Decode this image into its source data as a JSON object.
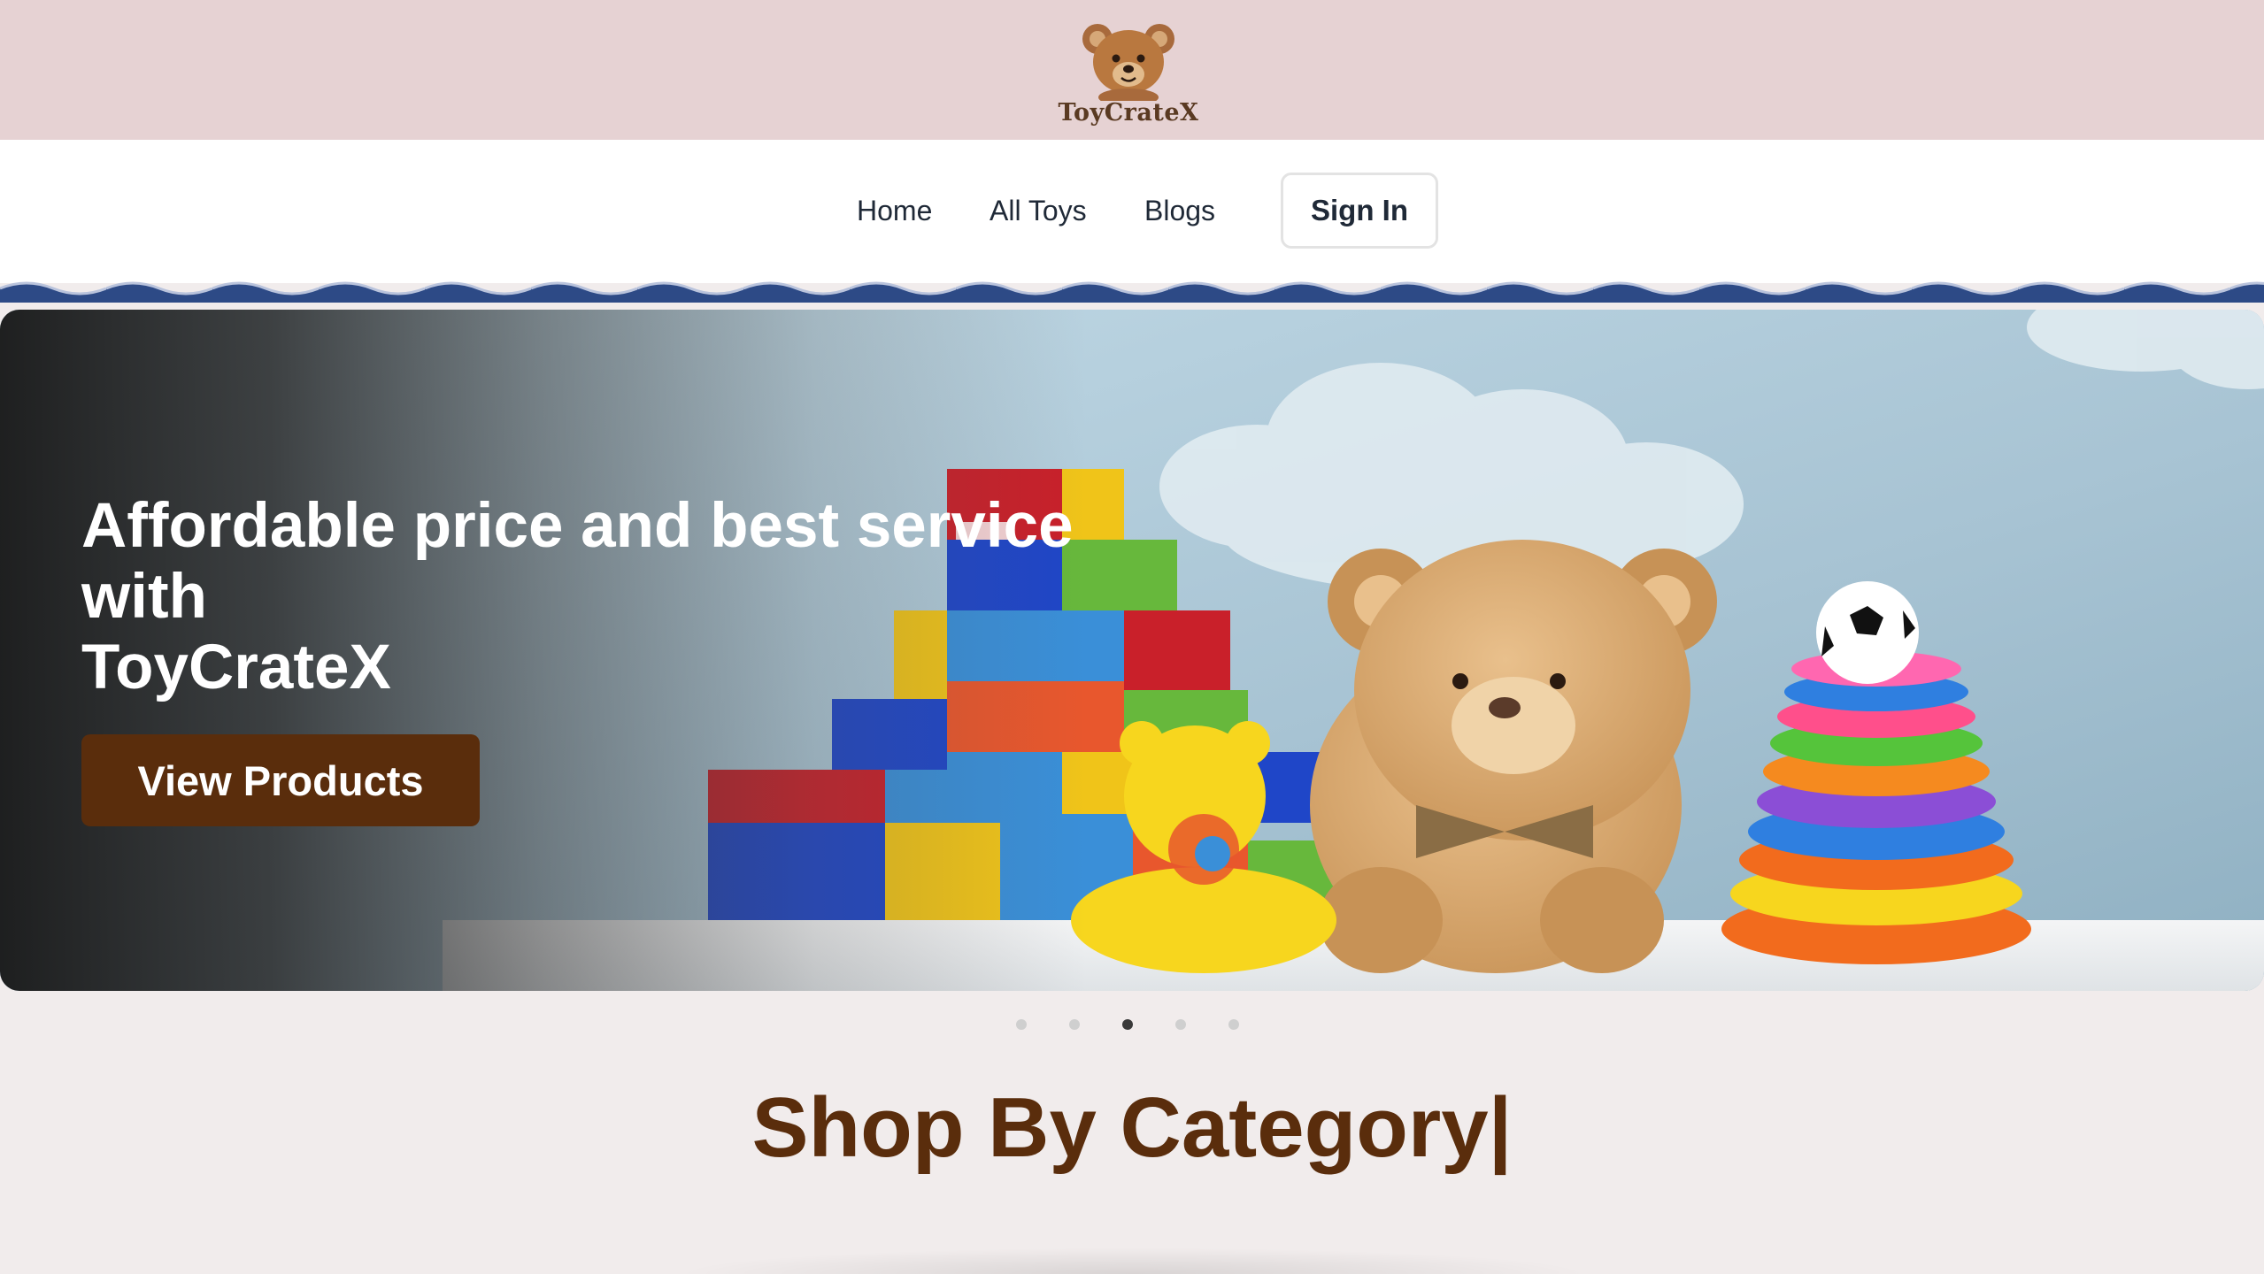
{
  "brand": {
    "name": "ToyCrateX",
    "logo_icon": "teddy-bear-icon"
  },
  "colors": {
    "banner": "#e6d2d3",
    "accent_brown": "#5a2d0c",
    "wave_blue": "#2d4a86",
    "page_bg": "#f1ecec"
  },
  "nav": {
    "links": [
      {
        "label": "Home"
      },
      {
        "label": "All Toys"
      },
      {
        "label": "Blogs"
      }
    ],
    "signin_label": "Sign In"
  },
  "hero": {
    "title_line1": "Affordable price and best service",
    "title_line2": "with",
    "title_line3": "ToyCrateX",
    "cta_label": "View Products"
  },
  "carousel": {
    "slide_count": 5,
    "active_slide": 3
  },
  "category": {
    "title": "Shop By Category",
    "cursor": "|"
  }
}
